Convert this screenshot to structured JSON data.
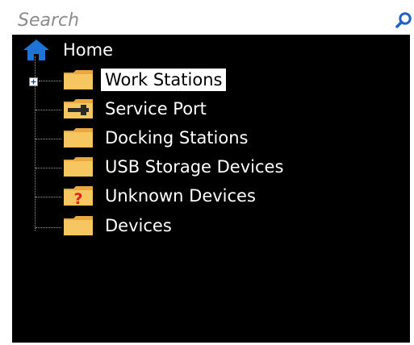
{
  "search": {
    "placeholder": "Search",
    "value": ""
  },
  "tree": {
    "root": {
      "label": "Home",
      "icon": "home-icon"
    },
    "items": [
      {
        "label": "Work Stations",
        "icon": "folder-icon",
        "selected": true,
        "expandable": true
      },
      {
        "label": "Service Port",
        "icon": "service-port-folder-icon",
        "selected": false,
        "expandable": false
      },
      {
        "label": "Docking Stations",
        "icon": "folder-icon",
        "selected": false,
        "expandable": false
      },
      {
        "label": "USB Storage Devices",
        "icon": "folder-icon",
        "selected": false,
        "expandable": false
      },
      {
        "label": "Unknown Devices",
        "icon": "unknown-folder-icon",
        "selected": false,
        "expandable": false
      },
      {
        "label": "Devices",
        "icon": "folder-icon",
        "selected": false,
        "expandable": false
      }
    ]
  },
  "colors": {
    "panel_background": "#000000",
    "home_icon": "#1e73d6",
    "folder": "#f5c15c",
    "unknown_mark": "#e81c1c",
    "search_icon": "#1e62c8"
  }
}
